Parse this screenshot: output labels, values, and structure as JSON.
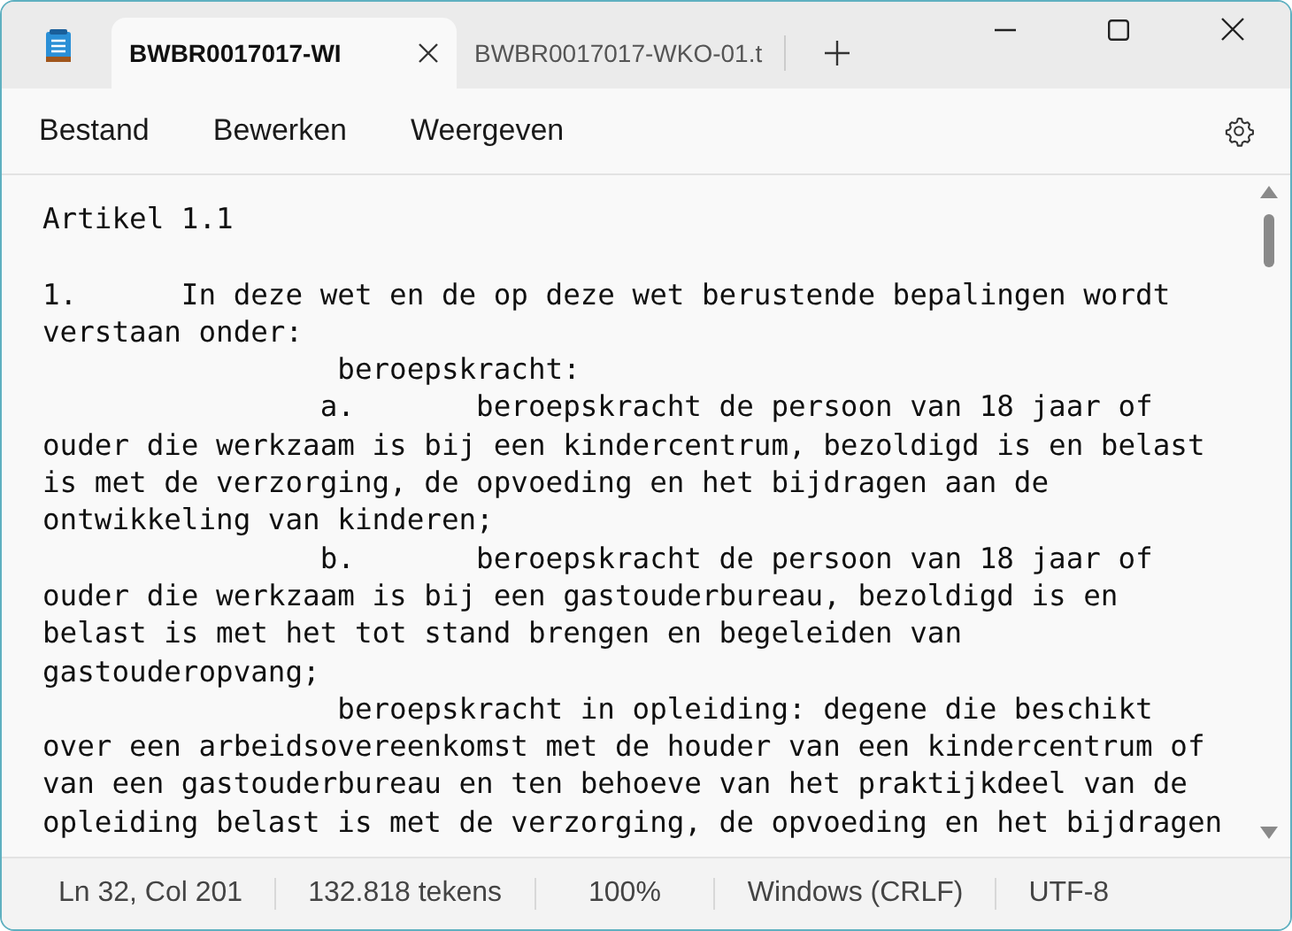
{
  "tabs": [
    {
      "label": "BWBR0017017-WI",
      "selected": true,
      "closable": true
    },
    {
      "label": "BWBR0017017-WKO-01.t",
      "selected": false,
      "closable": false
    }
  ],
  "menu": [
    "Bestand",
    "Bewerken",
    "Weergeven"
  ],
  "lines": [
    {
      "kind": "heading",
      "text": "Artikel 1.1"
    },
    {
      "kind": "text",
      "text": "1.      In deze wet en de op deze wet berustende bepalingen wordt"
    },
    {
      "kind": "text",
      "text": "verstaan onder:"
    },
    {
      "kind": "text",
      "text": "                 beroepskracht:"
    },
    {
      "kind": "text",
      "text": "                a.       beroepskracht de persoon van 18 jaar of"
    },
    {
      "kind": "text",
      "text": "ouder die werkzaam is bij een kindercentrum, bezoldigd is en belast"
    },
    {
      "kind": "text",
      "text": "is met de verzorging, de opvoeding en het bijdragen aan de"
    },
    {
      "kind": "text",
      "text": "ontwikkeling van kinderen;"
    },
    {
      "kind": "text",
      "text": "                b.       beroepskracht de persoon van 18 jaar of"
    },
    {
      "kind": "text",
      "text": "ouder die werkzaam is bij een gastouderbureau, bezoldigd is en"
    },
    {
      "kind": "text",
      "text": "belast is met het tot stand brengen en begeleiden van"
    },
    {
      "kind": "text",
      "text": "gastouderopvang;"
    },
    {
      "kind": "text",
      "text": "                 beroepskracht in opleiding: degene die beschikt"
    },
    {
      "kind": "text",
      "text": "over een arbeidsovereenkomst met de houder van een kindercentrum of"
    },
    {
      "kind": "text",
      "text": "van een gastouderbureau en ten behoeve van het praktijkdeel van de"
    },
    {
      "kind": "text",
      "text": "opleiding belast is met de verzorging, de opvoeding en het bijdragen"
    }
  ],
  "status_bar": [
    "Ln 32, Col 201",
    "132.818 tekens",
    "100%",
    "Windows (CRLF)",
    "UTF-8"
  ]
}
